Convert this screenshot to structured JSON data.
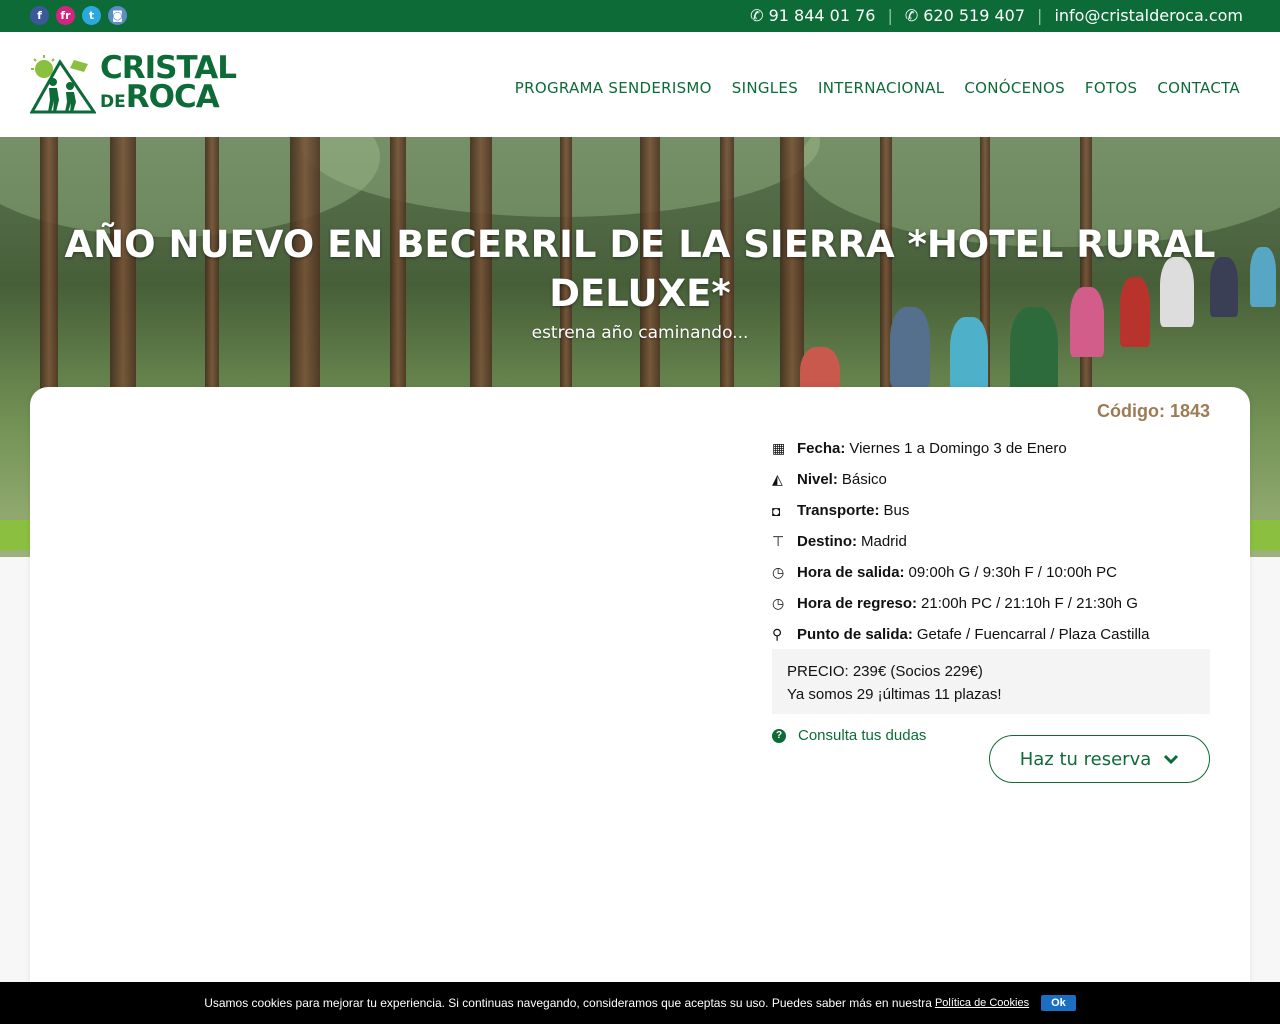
{
  "topbar": {
    "social": [
      {
        "icon": "facebook-icon",
        "glyph": "f",
        "color": "#3b5998"
      },
      {
        "icon": "flickr-icon",
        "glyph": "fr",
        "color": "#d5247f"
      },
      {
        "icon": "twitter-icon",
        "glyph": "t",
        "color": "#2aa9e0"
      },
      {
        "icon": "instagram-icon",
        "glyph": "◙",
        "color": "#5b8ec4"
      }
    ],
    "phone": "91 844 01 76",
    "whatsapp": "620 519 407",
    "email": "info@cristalderoca.com"
  },
  "logo": {
    "line1": "CRISTAL",
    "line2_small": "DE",
    "line2": "ROCA"
  },
  "nav": {
    "items": [
      "PROGRAMA SENDERISMO",
      "SINGLES",
      "INTERNACIONAL",
      "CONÓCENOS",
      "FOTOS",
      "CONTACTA"
    ]
  },
  "hero": {
    "title": "AÑO NUEVO EN BECERRIL DE LA SIERRA *HOTEL RURAL DELUXE*",
    "subtitle": "estrena año caminando..."
  },
  "trip": {
    "code": "Código: 1843",
    "details": [
      {
        "icon": "calendar-icon",
        "glyph": "▦",
        "label": "Fecha:",
        "value": "Viernes 1 a Domingo 3 de Enero"
      },
      {
        "icon": "mountain-chart-icon",
        "glyph": "◭",
        "label": "Nivel:",
        "value": "Básico"
      },
      {
        "icon": "bus-icon",
        "glyph": "◘",
        "label": "Transporte:",
        "value": "Bus"
      },
      {
        "icon": "signpost-icon",
        "glyph": "⊤",
        "label": "Destino:",
        "value": "Madrid"
      },
      {
        "icon": "clock-icon",
        "glyph": "◷",
        "label": "Hora de salida:",
        "value": "09:00h G / 9:30h F / 10:00h PC"
      },
      {
        "icon": "clock-icon",
        "glyph": "◷",
        "label": "Hora de regreso:",
        "value": "21:00h PC / 21:10h F / 21:30h G"
      },
      {
        "icon": "map-pin-icon",
        "glyph": "⚲",
        "label": "Punto de salida:",
        "value": "Getafe / Fuencarral / Plaza Castilla"
      }
    ],
    "price": "PRECIO: 239€ (Socios 229€)",
    "places": "Ya somos 29 ¡últimas 11 plazas!",
    "consulta": "Consulta tus dudas",
    "reserva": "Haz tu reserva"
  },
  "cookie": {
    "text": "Usamos cookies para mejorar tu experiencia. Si continuas navegando, consideramos que aceptas su uso. Puedes saber más en nuestra",
    "link": "Política de Cookies",
    "ok": "Ok"
  },
  "colors": {
    "brand_green": "#0d6b37",
    "code_brown": "#9c7b55",
    "accent_lime": "#8bbf3f"
  }
}
